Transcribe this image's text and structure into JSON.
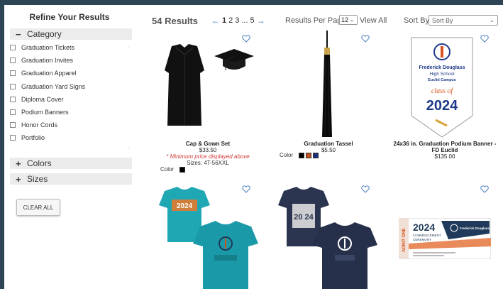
{
  "sidebar": {
    "title": "Refine Your Results",
    "category_label": "Category",
    "categories": [
      "Graduation Tickets",
      "Graduation Invites",
      "Graduation Apparel",
      "Graduation Yard Signs",
      "Diploma Cover",
      "Podium Banners",
      "Honor Cords",
      "Portfolio"
    ],
    "colors_label": "Colors",
    "sizes_label": "Sizes",
    "clear_all": "CLEAR ALL",
    "minus": "−",
    "plus": "+"
  },
  "toolbar": {
    "results": "54 Results",
    "pager": {
      "prev": "←",
      "pages": [
        "1",
        "2",
        "3",
        "...",
        "5"
      ],
      "next": "→"
    },
    "rpp_label": "Results Per Page",
    "rpp_value": "12",
    "view_all": "View All",
    "sort_label": "Sort By",
    "sort_value": "Sort By"
  },
  "products": [
    {
      "name": "Cap & Gown Set",
      "price": "$33.50",
      "note": "* Minimum price displayed above",
      "sizes": "Sizes: 4T-56XXL",
      "color_label": "Color",
      "swatches": [
        "#000000"
      ]
    },
    {
      "name": "Graduation Tassel",
      "price": "$5.50",
      "color_label": "Color",
      "swatches": [
        "#000000",
        "#c0501e",
        "#1e2d7a"
      ]
    },
    {
      "name": "24x36 in. Graduation Podium Banner - FD Euclid",
      "price": "$135.00",
      "banner": {
        "school1": "Frederick Douglass",
        "school2": "High School",
        "school3": "Euclid Campus",
        "class_of": "class of",
        "year": "2024"
      }
    },
    {
      "name": "",
      "price": "",
      "shirt_text": "2024"
    },
    {
      "name": "",
      "price": "",
      "shirt_text": "20 24"
    },
    {
      "name": "",
      "price": "",
      "ticket": {
        "year": "2024",
        "line1": "COMMENCEMENT",
        "line2": "CEREMONY",
        "side": "ADMIT ONE",
        "school": "Frederick Douglass"
      }
    }
  ],
  "colors": {
    "accent": "#2a6fb3",
    "frame": "#2e4556",
    "heart": "#4a7fc1",
    "teal": "#1fa7b4",
    "navy": "#2b3550"
  }
}
